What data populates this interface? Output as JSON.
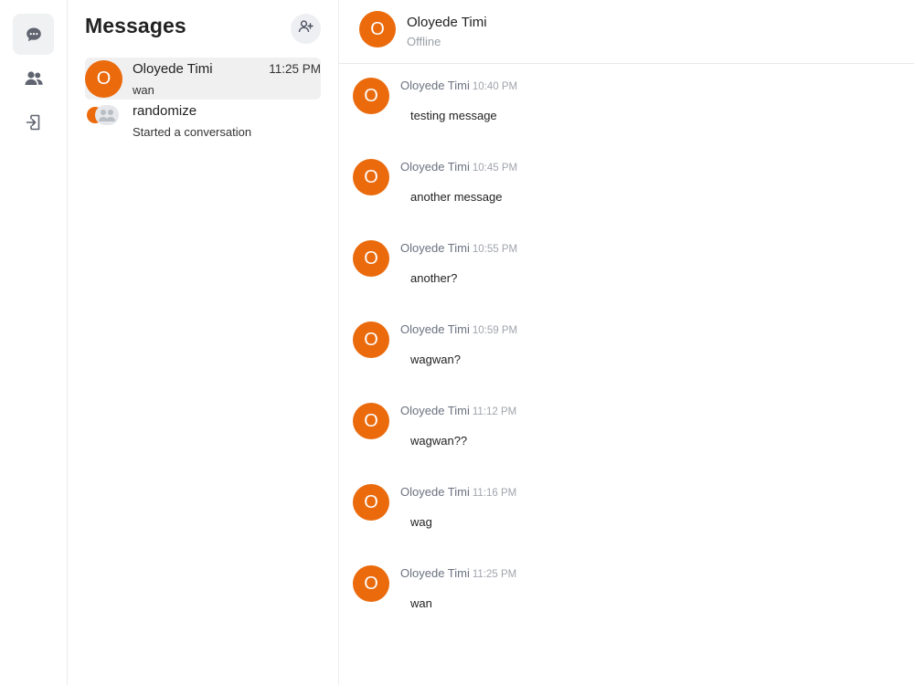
{
  "rail": {
    "items": [
      {
        "name": "chats",
        "icon": "chat-bubble-icon",
        "active": true
      },
      {
        "name": "contacts",
        "icon": "users-icon",
        "active": false
      },
      {
        "name": "logout",
        "icon": "sign-out-icon",
        "active": false
      }
    ]
  },
  "sidebar": {
    "title": "Messages",
    "new_chat_icon": "add-user-icon",
    "conversations": [
      {
        "avatar_letter": "O",
        "name": "Oloyede Timi",
        "time": "11:25 PM",
        "preview": "wan",
        "selected": true
      },
      {
        "avatar_letter": "",
        "name": "randomize",
        "time": "",
        "preview": "Started a conversation",
        "selected": false,
        "group": true
      }
    ]
  },
  "chat": {
    "header": {
      "avatar_letter": "O",
      "name": "Oloyede Timi",
      "status": "Offline"
    },
    "messages": [
      {
        "avatar_letter": "O",
        "author": "Oloyede Timi",
        "time": "10:40 PM",
        "text": "testing message"
      },
      {
        "avatar_letter": "O",
        "author": "Oloyede Timi",
        "time": "10:45 PM",
        "text": "another message"
      },
      {
        "avatar_letter": "O",
        "author": "Oloyede Timi",
        "time": "10:55 PM",
        "text": "another?"
      },
      {
        "avatar_letter": "O",
        "author": "Oloyede Timi",
        "time": "10:59 PM",
        "text": "wagwan?"
      },
      {
        "avatar_letter": "O",
        "author": "Oloyede Timi",
        "time": "11:12 PM",
        "text": "wagwan??"
      },
      {
        "avatar_letter": "O",
        "author": "Oloyede Timi",
        "time": "11:16 PM",
        "text": "wag"
      },
      {
        "avatar_letter": "O",
        "author": "Oloyede Timi",
        "time": "11:25 PM",
        "text": "wan"
      }
    ]
  },
  "colors": {
    "accent": "#ea6a0c",
    "icon": "#5f6470",
    "border": "#ececec"
  }
}
